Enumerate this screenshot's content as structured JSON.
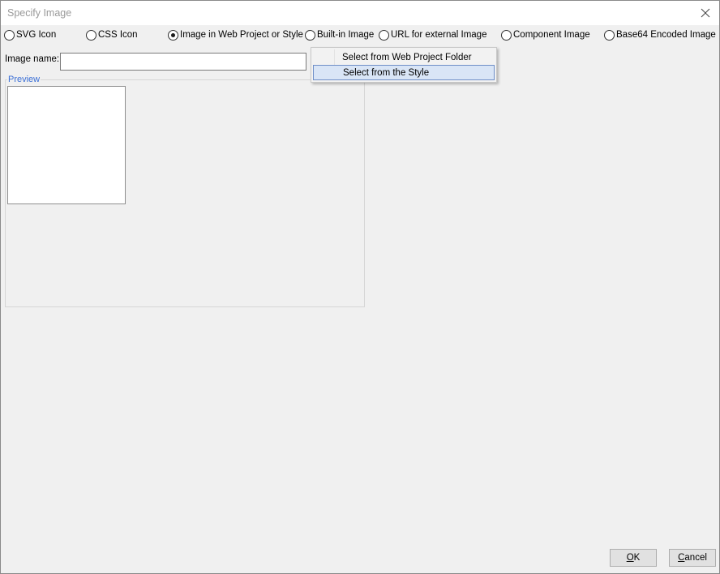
{
  "window": {
    "title": "Specify Image",
    "close_glyph": "✕"
  },
  "image_types": [
    {
      "label": "SVG Icon",
      "checked": false
    },
    {
      "label": "CSS Icon",
      "checked": false
    },
    {
      "label": "Image in Web Project or Style",
      "checked": true
    },
    {
      "label": "Built-in Image",
      "checked": false
    },
    {
      "label": "URL for external Image",
      "checked": false
    },
    {
      "label": "Component Image",
      "checked": false
    },
    {
      "label": "Base64 Encoded Image",
      "checked": false
    }
  ],
  "image_name": {
    "label": "Image name:",
    "value": ""
  },
  "preview": {
    "legend": "Preview"
  },
  "popup_menu": {
    "items": [
      {
        "label": "Select from Web Project Folder",
        "highlighted": false
      },
      {
        "label": "Select from the Style",
        "highlighted": true
      }
    ]
  },
  "buttons": {
    "ok": {
      "mnemonic": "O",
      "rest": "K"
    },
    "cancel": {
      "mnemonic": "C",
      "rest": "ancel"
    }
  },
  "colors": {
    "preview_legend": "#3b6fd6",
    "menu_highlight": "#d9e5f6",
    "menu_highlight_border": "#6f8fc8"
  }
}
